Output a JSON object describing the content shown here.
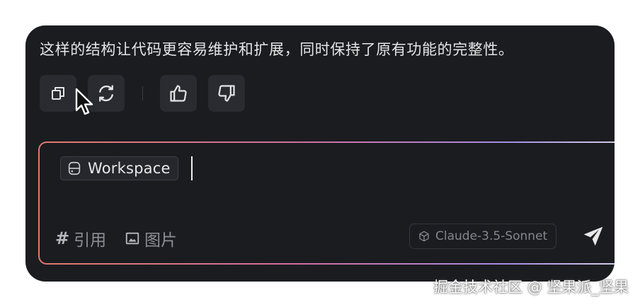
{
  "message": {
    "text": "这样的结构让代码更容易维护和扩展，同时保持了原有功能的完整性。"
  },
  "actions": [
    {
      "name": "copy",
      "icon": "copy-icon"
    },
    {
      "name": "regenerate",
      "icon": "refresh-icon"
    },
    {
      "name": "thumbs-up",
      "icon": "thumbs-up-icon"
    },
    {
      "name": "thumbs-down",
      "icon": "thumbs-down-icon"
    }
  ],
  "composer": {
    "chip_label": "Workspace",
    "chip_icon": "database-icon",
    "tools": {
      "cite_label": "引用",
      "image_label": "图片"
    },
    "model_label": "Claude-3.5-Sonnet",
    "model_icon": "cube-icon",
    "send_icon": "send-icon"
  },
  "colors": {
    "panel_bg": "#1b1c20",
    "border_gradient": [
      "#e07a6c",
      "#cf6fa0",
      "#a58ee0",
      "#d8cfe8"
    ]
  },
  "watermark": "掘金技术社区 @ 坚果派_坚果"
}
